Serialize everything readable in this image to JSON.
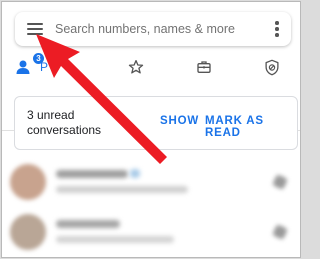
{
  "search": {
    "placeholder": "Search numbers, names & more"
  },
  "tabs": [
    {
      "name": "messages",
      "label": "P",
      "badge": "3",
      "icon": "people-icon",
      "active": true
    },
    {
      "name": "favorites",
      "icon": "star-icon"
    },
    {
      "name": "business",
      "icon": "briefcase-icon"
    },
    {
      "name": "spam",
      "icon": "shield-icon"
    }
  ],
  "unread_card": {
    "text": "3 unread conversations",
    "show_label": "SHOW",
    "mark_read_label": "MARK AS READ"
  },
  "colors": {
    "accent": "#1a73e8",
    "arrow": "#ec1c24"
  }
}
